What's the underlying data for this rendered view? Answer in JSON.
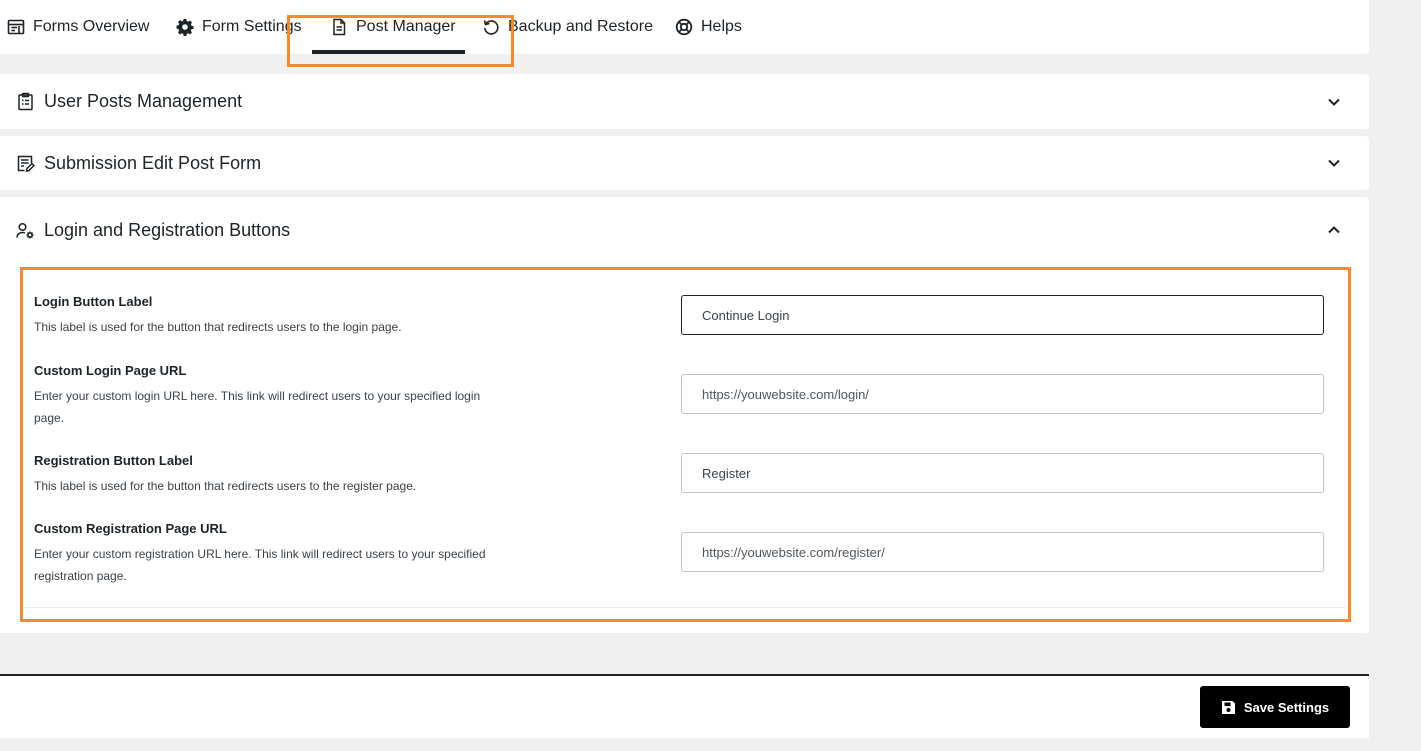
{
  "tabs": [
    {
      "label": "Forms Overview",
      "icon": "forms-overview-icon"
    },
    {
      "label": "Form Settings",
      "icon": "gear-icon"
    },
    {
      "label": "Post Manager",
      "icon": "document-icon"
    },
    {
      "label": "Backup and Restore",
      "icon": "restore-icon"
    },
    {
      "label": "Helps",
      "icon": "lifebuoy-icon"
    }
  ],
  "active_tab": "Post Manager",
  "sections": [
    {
      "title": "User Posts Management",
      "icon": "clipboard-icon",
      "expanded": false
    },
    {
      "title": "Submission Edit Post Form",
      "icon": "edit-form-icon",
      "expanded": false
    },
    {
      "title": "Login and Registration Buttons",
      "icon": "user-settings-icon",
      "expanded": true
    }
  ],
  "fields": [
    {
      "label": "Login Button Label",
      "description": "This label is used for the button that redirects users to the login page.",
      "value": "Continue Login",
      "placeholder": ""
    },
    {
      "label": "Custom Login Page URL",
      "description": "Enter your custom login URL here. This link will redirect users to your specified login page.",
      "value": "",
      "placeholder": "https://youwebsite.com/login/"
    },
    {
      "label": "Registration Button Label",
      "description": "This label is used for the button that redirects users to the register page.",
      "value": "Register",
      "placeholder": ""
    },
    {
      "label": "Custom Registration Page URL",
      "description": "Enter your custom registration URL here. This link will redirect users to your specified registration page.",
      "value": "",
      "placeholder": "https://youwebsite.com/register/"
    }
  ],
  "footer": {
    "save_label": "Save Settings",
    "save_icon": "floppy-disk-icon"
  },
  "colors": {
    "highlight": "#f58a2d",
    "primary": "#000000",
    "background": "#f0f0f1"
  }
}
